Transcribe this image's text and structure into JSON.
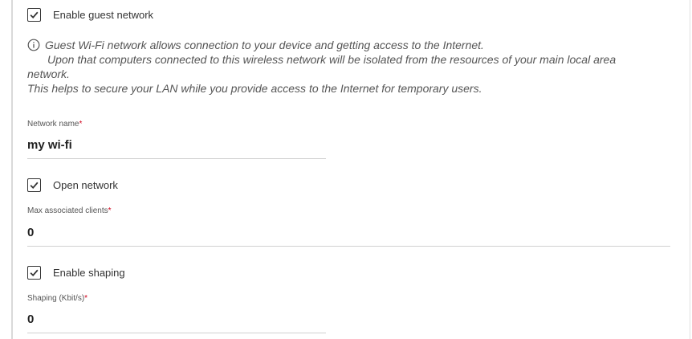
{
  "guest": {
    "enable_label": "Enable guest network",
    "enable_checked": true
  },
  "info": {
    "line1": "Guest Wi-Fi network allows connection to your device and getting access to the Internet.",
    "line2": "Upon that computers connected to this wireless network will be isolated from the resources of your main local area",
    "line3": "network.",
    "line4": "This helps to secure your LAN while you provide access to the Internet for temporary users.",
    "icon": "info-icon"
  },
  "network_name": {
    "label": "Network name",
    "required_mark": "*",
    "value": "my wi-fi"
  },
  "open_network": {
    "label": "Open network",
    "checked": true
  },
  "max_clients": {
    "label": "Max associated clients",
    "required_mark": "*",
    "value": "0"
  },
  "shaping": {
    "enable_label": "Enable shaping",
    "enable_checked": true,
    "label": "Shaping (Kbit/s)",
    "required_mark": "*",
    "value": "0"
  }
}
